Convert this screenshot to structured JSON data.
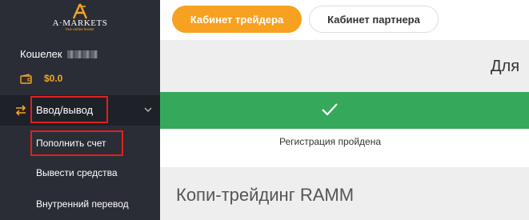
{
  "sidebar": {
    "logo_text": "A·MARKETS",
    "logo_sub": "true online broker",
    "wallet_label": "Кошелек",
    "balance": "$0.0",
    "nav": {
      "deposit_withdraw": "Ввод/вывод",
      "sub_items": [
        "Пополнить счет",
        "Вывести средства",
        "Внутренний перевод"
      ]
    }
  },
  "topbar": {
    "trader_cabinet": "Кабинет трейдера",
    "partner_cabinet": "Кабинет партнера"
  },
  "main": {
    "heading_partial": "Для",
    "registration_status": "Регистрация пройдена",
    "copy_trading_title": "Копи-трейдинг RAMM"
  },
  "colors": {
    "accent": "#f7a120",
    "success": "#36a85b",
    "sidebar_bg": "#2a2d35",
    "highlight": "#e02020"
  },
  "icons": [
    "logo-icon",
    "wallet-icon",
    "transfer-icon",
    "chevron-down-icon",
    "check-icon"
  ]
}
